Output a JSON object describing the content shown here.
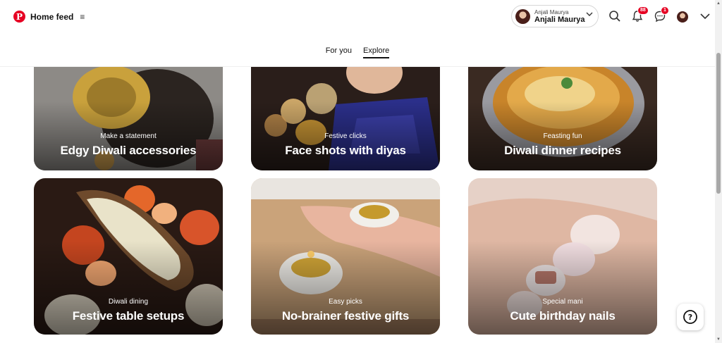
{
  "header": {
    "brand_title": "Home feed",
    "logo_letter": "P",
    "account": {
      "small_name": "Anjali Maurya",
      "big_name": "Anjali Maurya"
    },
    "notifications_count": "88",
    "messages_count": "1"
  },
  "tabs": [
    {
      "label": "For you",
      "active": false
    },
    {
      "label": "Explore",
      "active": true
    }
  ],
  "cards": [
    {
      "subtitle": "Make a statement",
      "title": "Edgy Diwali accessories"
    },
    {
      "subtitle": "Festive clicks",
      "title": "Face shots with diyas"
    },
    {
      "subtitle": "Feasting fun",
      "title": "Diwali dinner recipes"
    },
    {
      "subtitle": "Diwali dining",
      "title": "Festive table setups"
    },
    {
      "subtitle": "Easy picks",
      "title": "No-brainer festive gifts"
    },
    {
      "subtitle": "Special mani",
      "title": "Cute birthday nails"
    }
  ],
  "help": {
    "glyph": "?"
  }
}
